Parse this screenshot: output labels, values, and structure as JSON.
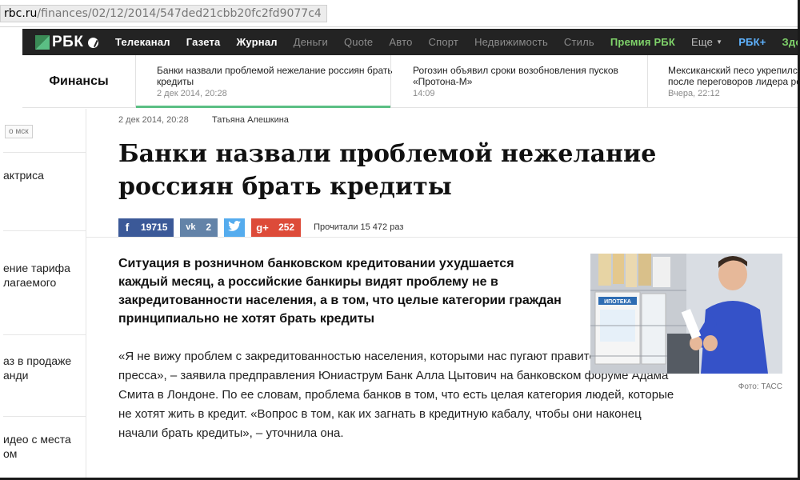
{
  "browser": {
    "url_host": "rbc.ru",
    "url_path": "/finances/02/12/2014/547ded21cbb20fc2fd9077c4"
  },
  "nav": {
    "logo_text": "РБК",
    "items": [
      "Телеканал",
      "Газета",
      "Журнал",
      "Деньги",
      "Quote",
      "Авто",
      "Спорт",
      "Недвижимость",
      "Стиль",
      "Премия РБК",
      "Еще",
      "РБК+",
      "Здо"
    ]
  },
  "ticker": {
    "section": "Финансы",
    "news": [
      {
        "title": "Банки назвали проблемой нежелание россиян брать кредиты",
        "time": "2 дек 2014, 20:28"
      },
      {
        "title": "Рогозин объявил сроки возобновления пусков «Протона-М»",
        "time": "14:09"
      },
      {
        "title": "Мексиканский песо укрепилс после переговоров лидера ре",
        "time": "Вчера, 22:12"
      }
    ]
  },
  "sidebar": {
    "time_label": "о мск",
    "items": [
      "актриса",
      "ение тарифа лагаемого",
      "аз в продаже анди",
      "идео с места ом"
    ]
  },
  "article": {
    "date": "2 дек 2014, 20:28",
    "author": "Татьяна Алешкина",
    "headline": "Банки назвали проблемой нежелание россиян брать кредиты",
    "share": {
      "fb": "19715",
      "vk": "2",
      "gp": "252",
      "reads": "Прочитали 15 472 раз"
    },
    "lead": "Ситуация в розничном банковском кредитовании ухудшается каждый месяц, а российские банкиры видят проблему не в закредитованности населения, а в том, что целые категории граждан принципиально не хотят брать кредиты",
    "body": "«Я не вижу проблем с закредитованностью населения, которыми нас пугают правительство и пресса», – заявила предправления Юниаструм Банк Алла Цытович на банковском форуме Адама Смита в Лондоне. По ее словам, проблема банков в том, что есть целая категория людей, которые не хотят жить в кредит. «Вопрос в том, как их загнать в кредитную кабалу, чтобы они наконец начали брать кредиты», – уточнила она.",
    "photo_caption": "Фото: ТАСС",
    "photo_sign": "ИПОТЕКА"
  },
  "colors": {
    "nav_bg": "#232323",
    "accent_green": "#5bbf84",
    "facebook": "#3b5998",
    "vk": "#6383a8",
    "twitter": "#55acee",
    "googleplus": "#dd4b39"
  }
}
